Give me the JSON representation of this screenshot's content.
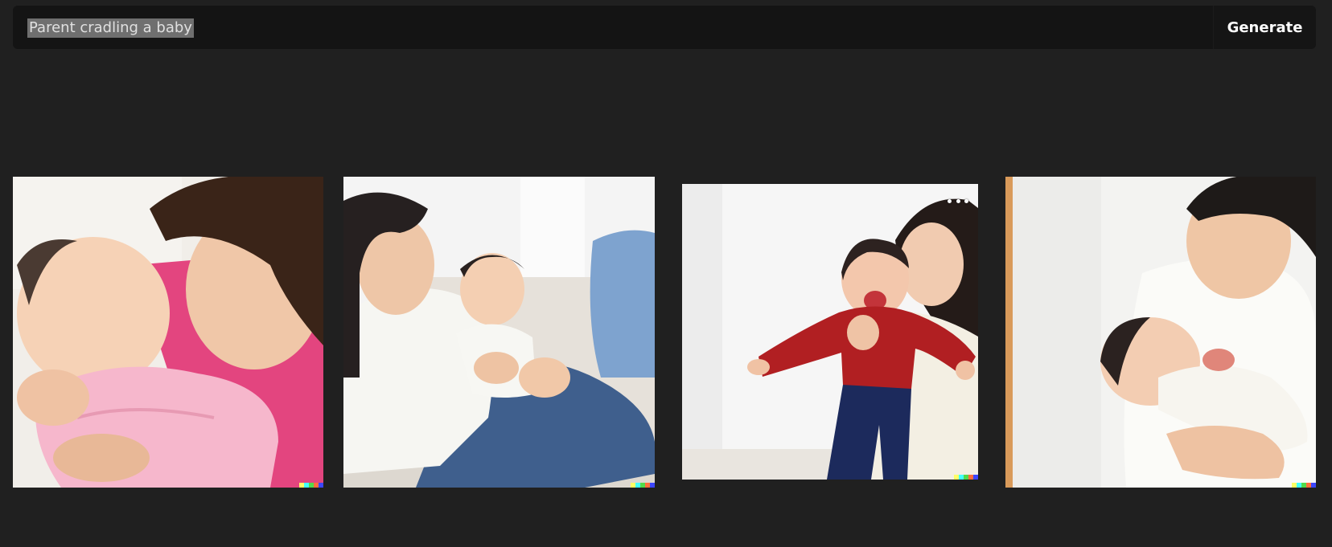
{
  "prompt": {
    "value": "Parent cradling a baby",
    "generate_label": "Generate"
  },
  "images": [
    {
      "name": "result-image-1",
      "has_menu": false
    },
    {
      "name": "result-image-2",
      "has_menu": false
    },
    {
      "name": "result-image-3",
      "has_menu": true,
      "menu_icon": "more-horizontal-icon"
    },
    {
      "name": "result-image-4",
      "has_menu": false
    }
  ],
  "colors": {
    "background": "#202020",
    "prompt_bar": "#141414",
    "selection_highlight": "#6f6f6f",
    "button_text": "#ffffff",
    "watermark": [
      "#ffff66",
      "#42ffff",
      "#51da4c",
      "#ff6e3c",
      "#3c46ff"
    ]
  }
}
